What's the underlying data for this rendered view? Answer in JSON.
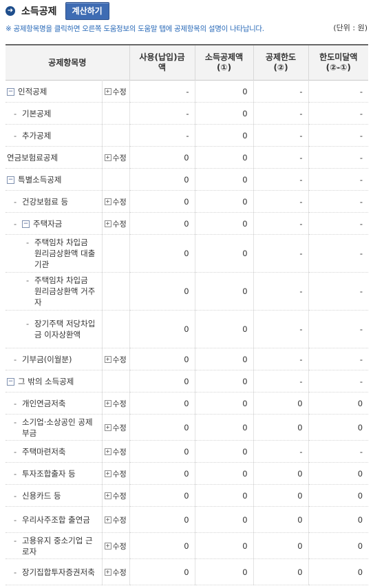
{
  "header": {
    "title": "소득공제",
    "calc_label": "계산하기"
  },
  "notice": "※ 공제항목명을 클릭하면 오른쪽 도움정보의 도움말 탭에 공제항목의 설명이 나타납니다.",
  "unit": "(단위 : 원)",
  "columns": [
    "공제항목명",
    "사용(납입)금액",
    "소득공제액(①)",
    "공제한도(②)",
    "한도미달액(②-①)"
  ],
  "rows": [
    {
      "name": "인적공제",
      "level": 0,
      "collapse": true,
      "mod": "수정",
      "amt": "-",
      "ded": "0",
      "limit": "-",
      "short": "-"
    },
    {
      "name": "기본공제",
      "level": 1,
      "mod": "",
      "amt": "-",
      "ded": "0",
      "limit": "-",
      "short": "-"
    },
    {
      "name": "추가공제",
      "level": 1,
      "mod": "",
      "amt": "-",
      "ded": "0",
      "limit": "-",
      "short": "-"
    },
    {
      "name": "연금보험료공제",
      "level": 0,
      "mod": "수정",
      "amt": "0",
      "ded": "0",
      "limit": "-",
      "short": "-"
    },
    {
      "name": "특별소득공제",
      "level": 0,
      "collapse": true,
      "mod": "",
      "amt": "0",
      "ded": "0",
      "limit": "-",
      "short": "-"
    },
    {
      "name": "건강보험료 등",
      "level": 1,
      "mod": "수정",
      "amt": "0",
      "ded": "0",
      "limit": "-",
      "short": "-"
    },
    {
      "name": "주택자금",
      "level": 1,
      "collapse": true,
      "mod": "수정",
      "amt": "0",
      "ded": "0",
      "limit": "-",
      "short": "-"
    },
    {
      "name": "주택임차 차입금 원리금상환액 대출기관",
      "level": 2,
      "mod": "",
      "amt": "0",
      "ded": "0",
      "limit": "-",
      "short": "-"
    },
    {
      "name": "주택임차 차입금 원리금상환액 거주자",
      "level": 2,
      "mod": "",
      "amt": "0",
      "ded": "0",
      "limit": "-",
      "short": "-"
    },
    {
      "name": "장기주택 저당차입금 이자상환액",
      "level": 2,
      "mod": "",
      "amt": "0",
      "ded": "0",
      "limit": "-",
      "short": "-"
    },
    {
      "name": "기부금(이월분)",
      "level": 1,
      "mod": "수정",
      "amt": "0",
      "ded": "0",
      "limit": "-",
      "short": "-"
    },
    {
      "name": "그 밖의 소득공제",
      "level": 0,
      "collapse": true,
      "mod": "",
      "amt": "0",
      "ded": "0",
      "limit": "-",
      "short": "-"
    },
    {
      "name": "개인연금저축",
      "level": 1,
      "mod": "수정",
      "amt": "0",
      "ded": "0",
      "limit": "0",
      "short": "0"
    },
    {
      "name": "소기업·소상공인 공제부금",
      "level": 1,
      "mod": "수정",
      "amt": "0",
      "ded": "0",
      "limit": "0",
      "short": "0"
    },
    {
      "name": "주택마련저축",
      "level": 1,
      "mod": "수정",
      "amt": "0",
      "ded": "0",
      "limit": "-",
      "short": "-"
    },
    {
      "name": "투자조합출자 등",
      "level": 1,
      "mod": "수정",
      "amt": "0",
      "ded": "0",
      "limit": "0",
      "short": "0"
    },
    {
      "name": "신용카드 등",
      "level": 1,
      "mod": "수정",
      "amt": "0",
      "ded": "0",
      "limit": "0",
      "short": "0"
    },
    {
      "name": "우리사주조합 출연금",
      "level": 1,
      "mod": "수정",
      "amt": "0",
      "ded": "0",
      "limit": "0",
      "short": "0"
    },
    {
      "name": "고용유지 중소기업 근로자",
      "level": 1,
      "mod": "수정",
      "amt": "0",
      "ded": "0",
      "limit": "0",
      "short": "0"
    },
    {
      "name": "장기집합투자증권저축",
      "level": 1,
      "mod": "수정",
      "amt": "0",
      "ded": "0",
      "limit": "0",
      "short": "0"
    }
  ]
}
